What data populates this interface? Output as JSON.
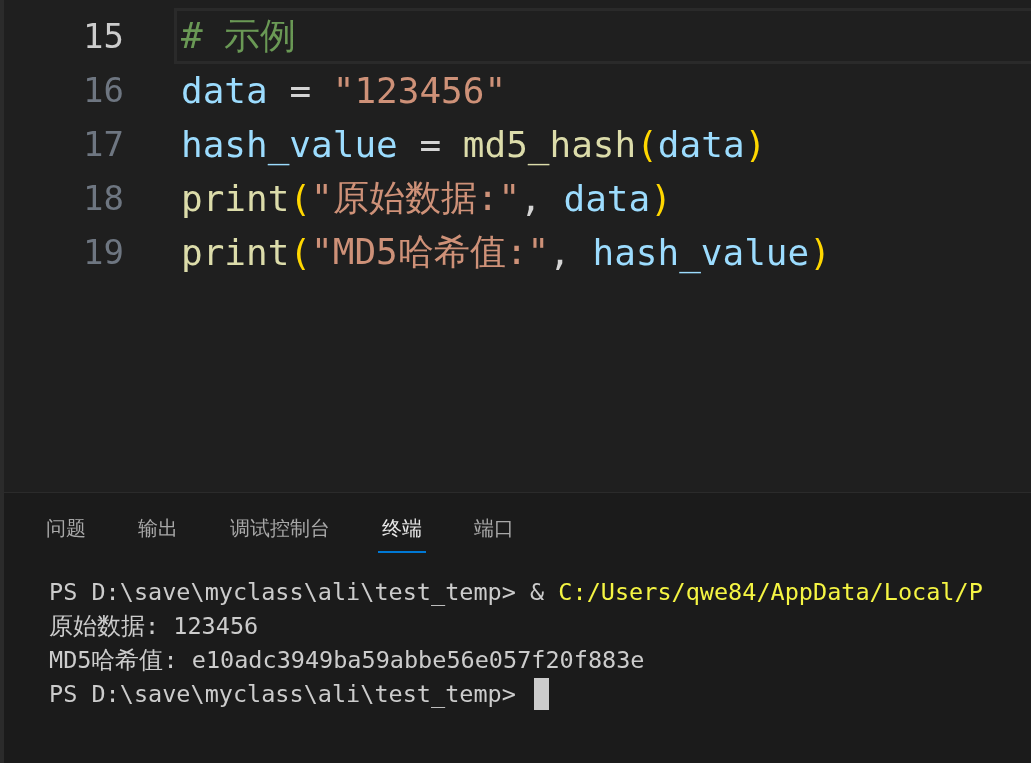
{
  "editor": {
    "lines": [
      {
        "number": "15",
        "selected": true,
        "tokens": [
          {
            "kind": "comment",
            "text": "# 示例"
          }
        ]
      },
      {
        "number": "16",
        "selected": false,
        "tokens": [
          {
            "kind": "variable",
            "text": "data"
          },
          {
            "kind": "operator",
            "text": " = "
          },
          {
            "kind": "string",
            "text": "\"123456\""
          }
        ]
      },
      {
        "number": "17",
        "selected": false,
        "tokens": [
          {
            "kind": "variable",
            "text": "hash_value"
          },
          {
            "kind": "operator",
            "text": " = "
          },
          {
            "kind": "function",
            "text": "md5_hash"
          },
          {
            "kind": "bracket",
            "text": "("
          },
          {
            "kind": "variable",
            "text": "data"
          },
          {
            "kind": "bracket",
            "text": ")"
          }
        ]
      },
      {
        "number": "18",
        "selected": false,
        "tokens": [
          {
            "kind": "function",
            "text": "print"
          },
          {
            "kind": "bracket",
            "text": "("
          },
          {
            "kind": "string",
            "text": "\"原始数据:\""
          },
          {
            "kind": "operator",
            "text": ", "
          },
          {
            "kind": "variable",
            "text": "data"
          },
          {
            "kind": "bracket",
            "text": ")"
          }
        ]
      },
      {
        "number": "19",
        "selected": false,
        "tokens": [
          {
            "kind": "function",
            "text": "print"
          },
          {
            "kind": "bracket",
            "text": "("
          },
          {
            "kind": "string",
            "text": "\"MD5哈希值:\""
          },
          {
            "kind": "operator",
            "text": ", "
          },
          {
            "kind": "variable",
            "text": "hash_value"
          },
          {
            "kind": "bracket",
            "text": ")"
          }
        ]
      }
    ]
  },
  "panel": {
    "tabs": [
      {
        "label": "问题",
        "selected": false
      },
      {
        "label": "输出",
        "selected": false
      },
      {
        "label": "调试控制台",
        "selected": false
      },
      {
        "label": "终端",
        "selected": true
      },
      {
        "label": "端口",
        "selected": false
      }
    ],
    "terminal": {
      "lines": [
        [
          {
            "kind": "plain",
            "text": "PS D:\\save\\myclass\\ali\\test_temp> & "
          },
          {
            "kind": "command",
            "text": "C:/Users/qwe84/AppData/Local/P"
          }
        ],
        [
          {
            "kind": "plain",
            "text": "原始数据: 123456"
          }
        ],
        [
          {
            "kind": "plain",
            "text": "MD5哈希值: e10adc3949ba59abbe56e057f20f883e"
          }
        ],
        [
          {
            "kind": "plain",
            "text": "PS D:\\save\\myclass\\ali\\test_temp> "
          }
        ]
      ]
    }
  }
}
